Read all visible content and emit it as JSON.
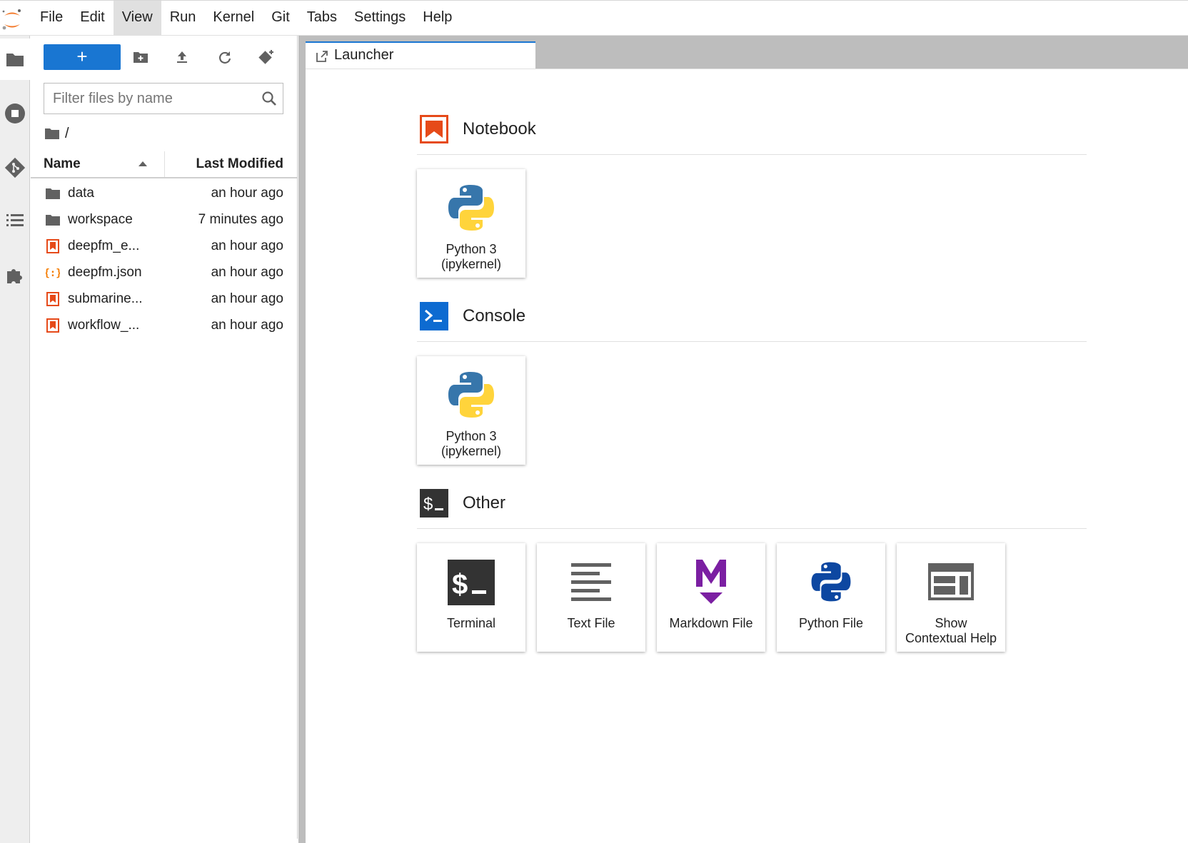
{
  "menubar": {
    "items": [
      {
        "label": "File"
      },
      {
        "label": "Edit"
      },
      {
        "label": "View"
      },
      {
        "label": "Run"
      },
      {
        "label": "Kernel"
      },
      {
        "label": "Git"
      },
      {
        "label": "Tabs"
      },
      {
        "label": "Settings"
      },
      {
        "label": "Help"
      }
    ],
    "active": "View"
  },
  "activitybar": {
    "icons": [
      "folder-icon",
      "running-icon",
      "git-icon",
      "table-of-contents-icon",
      "extension-icon"
    ]
  },
  "filebrowser": {
    "new_button_label": "+",
    "filter_placeholder": "Filter files by name",
    "breadcrumb_path": "/",
    "columns": {
      "name": "Name",
      "modified": "Last Modified"
    },
    "files": [
      {
        "name": "data",
        "modified": "an hour ago",
        "type": "folder"
      },
      {
        "name": "workspace",
        "modified": "7 minutes ago",
        "type": "folder"
      },
      {
        "name": "deepfm_e...",
        "modified": "an hour ago",
        "type": "notebook"
      },
      {
        "name": "deepfm.json",
        "modified": "an hour ago",
        "type": "json"
      },
      {
        "name": "submarine...",
        "modified": "an hour ago",
        "type": "notebook"
      },
      {
        "name": "workflow_...",
        "modified": "an hour ago",
        "type": "notebook"
      }
    ]
  },
  "launcher": {
    "tab_label": "Launcher",
    "sections": {
      "notebook": {
        "label": "Notebook",
        "cards": [
          {
            "line1": "Python 3",
            "line2": "(ipykernel)"
          }
        ]
      },
      "console": {
        "label": "Console",
        "cards": [
          {
            "line1": "Python 3",
            "line2": "(ipykernel)"
          }
        ]
      },
      "other": {
        "label": "Other",
        "cards": [
          {
            "line1": "Terminal",
            "line2": ""
          },
          {
            "line1": "Text File",
            "line2": ""
          },
          {
            "line1": "Markdown File",
            "line2": ""
          },
          {
            "line1": "Python File",
            "line2": ""
          },
          {
            "line1": "Show",
            "line2": "Contextual Help"
          }
        ]
      }
    }
  },
  "colors": {
    "accent": "#1976d2",
    "notebook_orange": "#f37726",
    "console_blue": "#0d6bd1",
    "markdown_purple": "#7b1fa2",
    "terminal_dark": "#333333"
  }
}
